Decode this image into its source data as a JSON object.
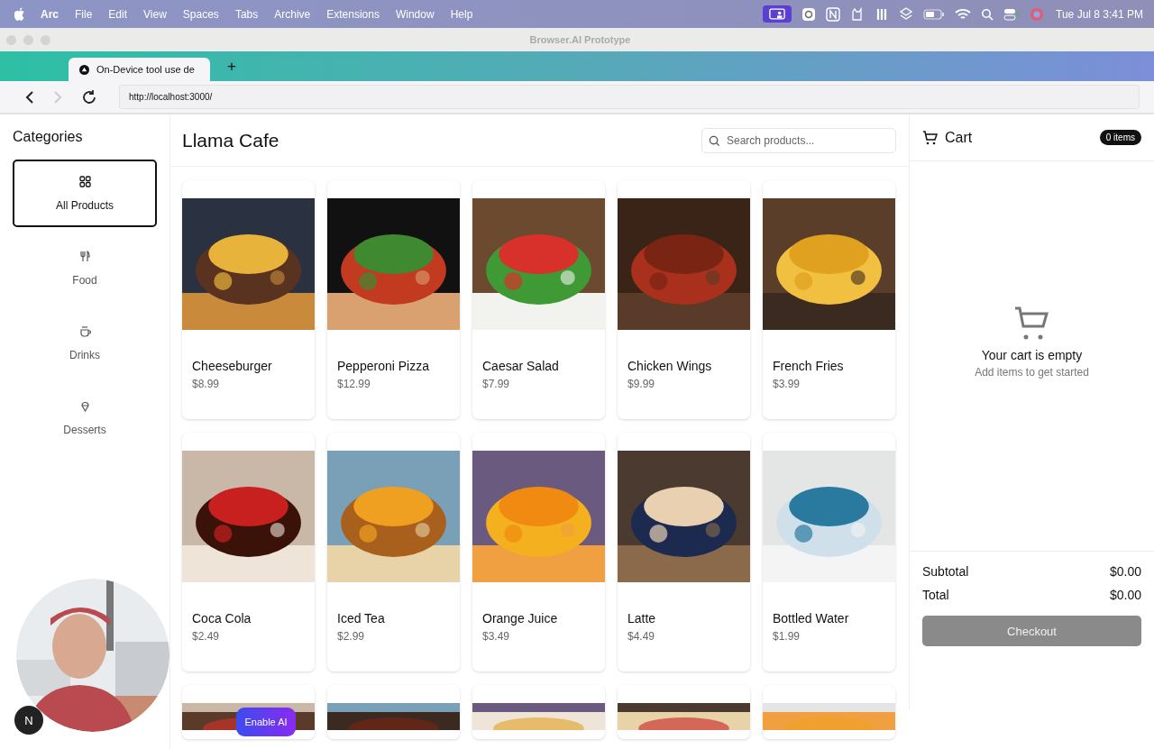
{
  "menu_bar": {
    "app": "Arc",
    "items": [
      "File",
      "Edit",
      "View",
      "Spaces",
      "Tabs",
      "Archive",
      "Extensions",
      "Window",
      "Help"
    ],
    "clock": "Tue Jul 8  3:41 PM"
  },
  "window": {
    "title": "Browser.AI Prototype"
  },
  "tabs": [
    {
      "label": "On-Device tool use de",
      "selected": true
    }
  ],
  "new_tab": "+",
  "address_bar": {
    "url": "http://localhost:3000/"
  },
  "sidebar": {
    "title": "Categories",
    "items": [
      {
        "label": "All Products",
        "selected": true
      },
      {
        "label": "Food",
        "selected": false
      },
      {
        "label": "Drinks",
        "selected": false
      },
      {
        "label": "Desserts",
        "selected": false
      }
    ]
  },
  "header": {
    "title": "Llama Cafe",
    "search": {
      "placeholder": "Search products..."
    }
  },
  "products": [
    {
      "name": "Cheeseburger",
      "price": "$8.99"
    },
    {
      "name": "Pepperoni Pizza",
      "price": "$12.99"
    },
    {
      "name": "Caesar Salad",
      "price": "$7.99"
    },
    {
      "name": "Chicken Wings",
      "price": "$9.99"
    },
    {
      "name": "French Fries",
      "price": "$3.99"
    },
    {
      "name": "Coca Cola",
      "price": "$2.49"
    },
    {
      "name": "Iced Tea",
      "price": "$2.99"
    },
    {
      "name": "Orange Juice",
      "price": "$3.49"
    },
    {
      "name": "Latte",
      "price": "$4.49"
    },
    {
      "name": "Bottled Water",
      "price": "$1.99"
    }
  ],
  "cart": {
    "title": "Cart",
    "count": "0 items",
    "empty_title": "Your cart is empty",
    "empty_hint": "Add items to get started",
    "totals": [
      {
        "label": "Subtotal",
        "value": "$0.00"
      },
      {
        "label": "Total",
        "value": "$0.00"
      }
    ],
    "checkout": {
      "label": "Checkout",
      "disabled": true
    }
  },
  "dev_badge": "N",
  "ai_button": "Enable AI"
}
